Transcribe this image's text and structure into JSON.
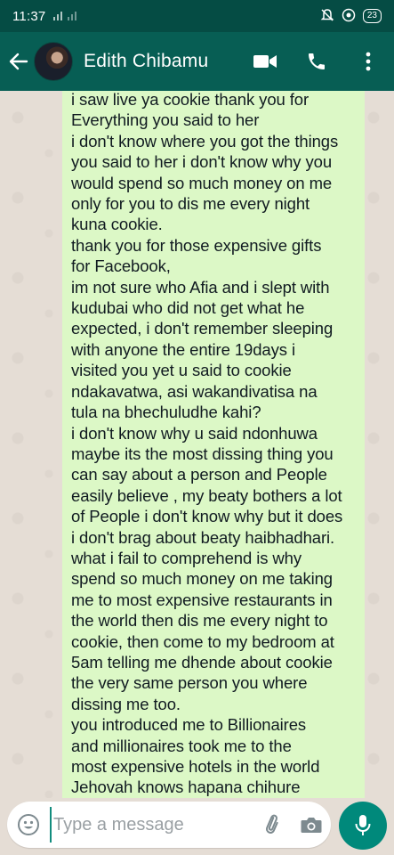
{
  "status_bar": {
    "time": "11:37",
    "signal": "ᵀᴵᴸ ılˣıl",
    "battery": "23"
  },
  "header": {
    "contact_name": "Edith Chibamu"
  },
  "message": {
    "lines": [
      "i saw live ya cookie thank you for",
      "Everything you  said to her",
      "i don't know where you got the things",
      "you said to her i don't know why you",
      "would spend so much money on me",
      "only for you to dis me every night",
      "kuna cookie.",
      "thank you for those expensive gifts",
      "for Facebook,",
      "im not sure who Afia and i slept with",
      "kudubai who did not get what he",
      "expected, i don't remember sleeping",
      "with anyone the entire 19days i",
      "visited you yet u said to cookie",
      "ndakavatwa, asi wakandivatisa na",
      "tula na bhechuludhe kahi?",
      "i don't know why u said ndonhuwa",
      "maybe its the most dissing thing you",
      "can say about a person and People",
      "easily believe , my beaty bothers a lot",
      "of People i don't know why but it does",
      "i don't brag about beaty haibhadhari.",
      "what i fail to comprehend  is why",
      "spend so much money on me taking",
      "me to most expensive restaurants in",
      "the world then dis me every night to",
      "cookie,  then come to my bedroom at",
      "5am telling me dhende about cookie",
      "the very same person you where",
      "dissing me too.",
      "you introduced me to Billionaires",
      "and millionaires took me to the",
      "most expensive hotels in the world",
      "Jehovah knows hapana chihure"
    ]
  },
  "composer": {
    "placeholder": "Type a message"
  },
  "colors": {
    "app_bar": "#075e54",
    "status_bar": "#054c44",
    "outgoing_bubble": "#dcf8c6",
    "chat_background": "#e5ddd5",
    "mic_button": "#00897b"
  },
  "icons": {
    "status": [
      "mute-alarm-icon",
      "at-sign-icon",
      "battery-icon"
    ],
    "header": [
      "back-arrow-icon",
      "video-call-icon",
      "voice-call-icon",
      "more-options-icon"
    ],
    "composer": [
      "emoji-icon",
      "attach-icon",
      "camera-icon",
      "mic-icon"
    ]
  }
}
